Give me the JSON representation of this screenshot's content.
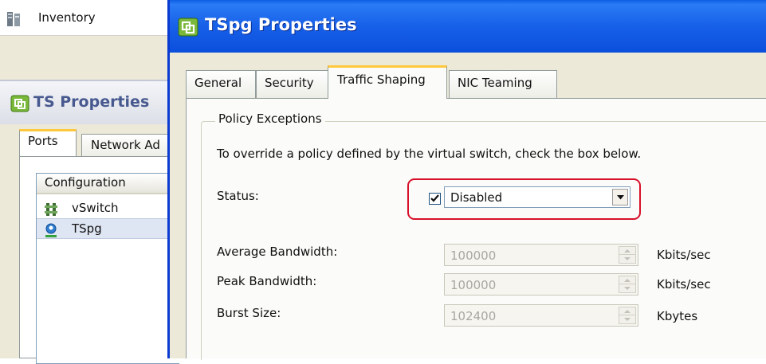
{
  "background": {
    "inventory_label": "Inventory",
    "ts_window": {
      "title": "TS Properties",
      "tabs": [
        {
          "label": "Ports",
          "active": true
        },
        {
          "label": "Network Ad",
          "active": false
        }
      ],
      "list_header": "Configuration",
      "rows": [
        {
          "label": "vSwitch",
          "icon": "switch-icon",
          "selected": false
        },
        {
          "label": "TSpg",
          "icon": "port-group-icon",
          "selected": true
        }
      ]
    }
  },
  "dialog": {
    "title": "TSpg Properties",
    "tabs": [
      {
        "label": "General",
        "active": false
      },
      {
        "label": "Security",
        "active": false
      },
      {
        "label": "Traffic Shaping",
        "active": true
      },
      {
        "label": "NIC Teaming",
        "active": false
      }
    ],
    "group_title": "Policy Exceptions",
    "instruction": "To override a policy defined by the virtual switch, check the box below.",
    "status": {
      "label": "Status:",
      "checked": true,
      "value": "Disabled"
    },
    "fields": [
      {
        "label": "Average Bandwidth:",
        "value": "100000",
        "unit": "Kbits/sec",
        "enabled": false
      },
      {
        "label": "Peak Bandwidth:",
        "value": "100000",
        "unit": "Kbits/sec",
        "enabled": false
      },
      {
        "label": "Burst Size:",
        "value": "102400",
        "unit": "Kbytes",
        "enabled": false
      }
    ],
    "highlight_color": "#d8102a",
    "title_bar_color": "#1760e8"
  }
}
